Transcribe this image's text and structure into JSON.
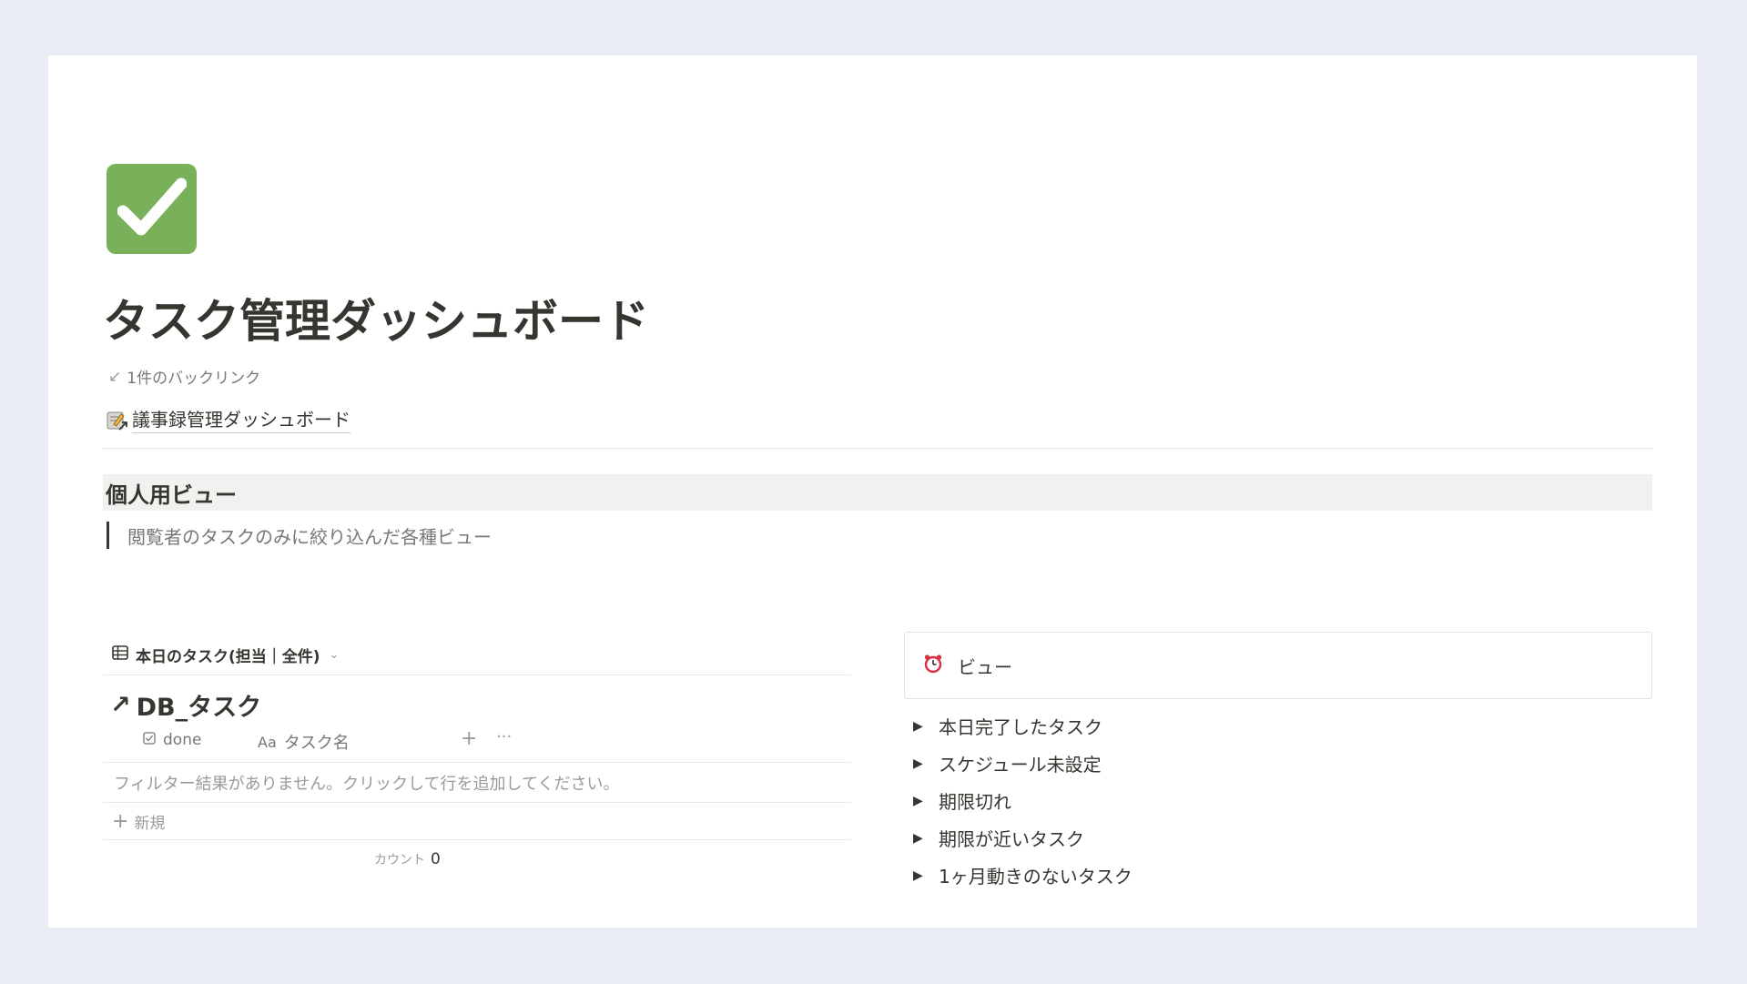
{
  "page": {
    "icon": "check-mark-button-icon",
    "title": "タスク管理ダッシュボード",
    "backlinks": "1件のバックリンク",
    "linked_page": {
      "icon": "memo-link-icon",
      "label": "議事録管理ダッシュボード"
    }
  },
  "section": {
    "heading": "個人用ビュー",
    "quote": "閲覧者のタスクのみに絞り込んだ各種ビュー"
  },
  "database": {
    "view_tab": "本日のタスク(担当｜全件)",
    "title": "DB_タスク",
    "columns": {
      "done": "done",
      "name_prefix": "Aa",
      "name": "タスク名"
    },
    "empty_message": "フィルター結果がありません。クリックして行を追加してください。",
    "new_label": "新規",
    "count_label": "カウント",
    "count_value": "0"
  },
  "right": {
    "callout": {
      "icon": "alarm-clock-icon",
      "label": "ビュー"
    },
    "toggles": [
      "本日完了したタスク",
      "スケジュール未設定",
      "期限切れ",
      "期限が近いタスク",
      "1ヶ月動きのないタスク"
    ]
  },
  "colors": {
    "background": "#e9ecf4",
    "check_icon": "#78b159",
    "heading_bg": "#f1f1ef",
    "text": "#37352f",
    "muted": "#787774"
  }
}
